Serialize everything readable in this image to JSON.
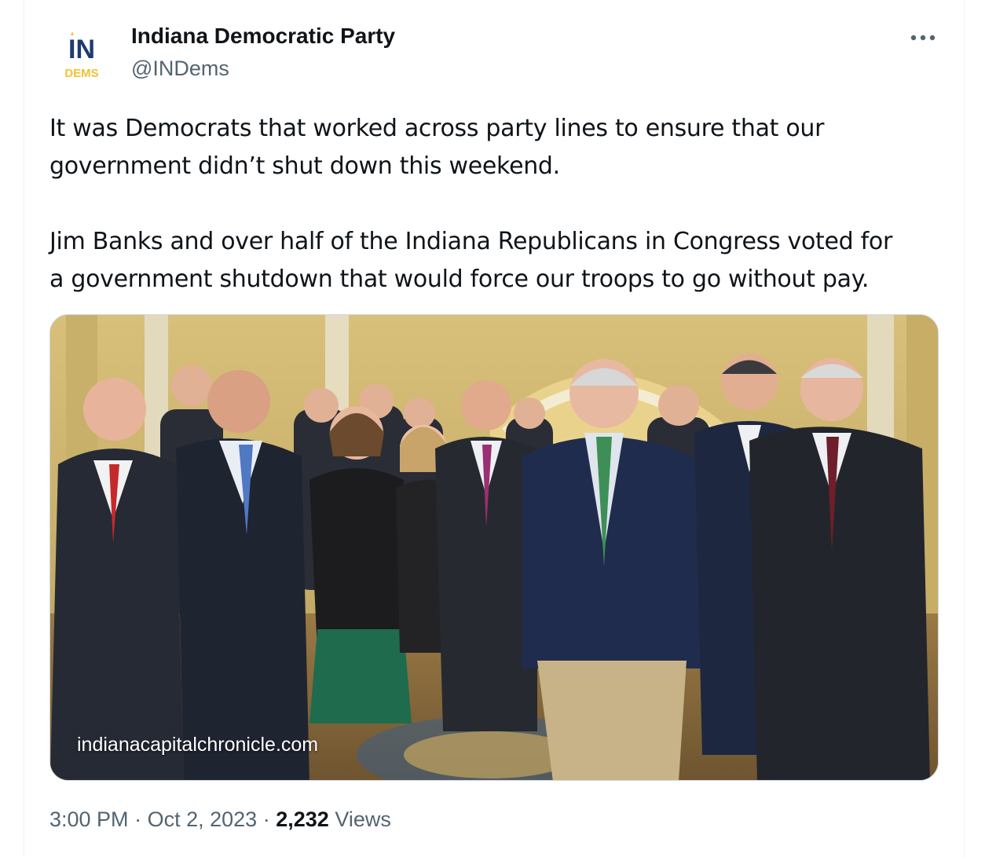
{
  "author": {
    "display_name": "Indiana Democratic Party",
    "handle": "@INDems",
    "avatar_logo_text": "IN",
    "avatar_logo_subtext": "DEMS"
  },
  "more_icon": "more-horizontal-icon",
  "tweet": {
    "paragraph_1": "It was Democrats that worked across party lines to ensure that our\ngovernment didn’t shut down this weekend.",
    "paragraph_2": "Jim Banks and over half of the Indiana Republicans in Congress voted for\na government shutdown that would force our troops to go without pay."
  },
  "media": {
    "watermark": "indianacapitalchronicle.com"
  },
  "meta": {
    "time": "3:00 PM",
    "separator": "·",
    "date": "Oct 2, 2023",
    "views_count": "2,232",
    "views_label": "Views"
  },
  "colors": {
    "text_primary": "#0f1419",
    "text_secondary": "#536471",
    "logo_navy": "#1d3a72",
    "logo_gold": "#f2c230"
  }
}
